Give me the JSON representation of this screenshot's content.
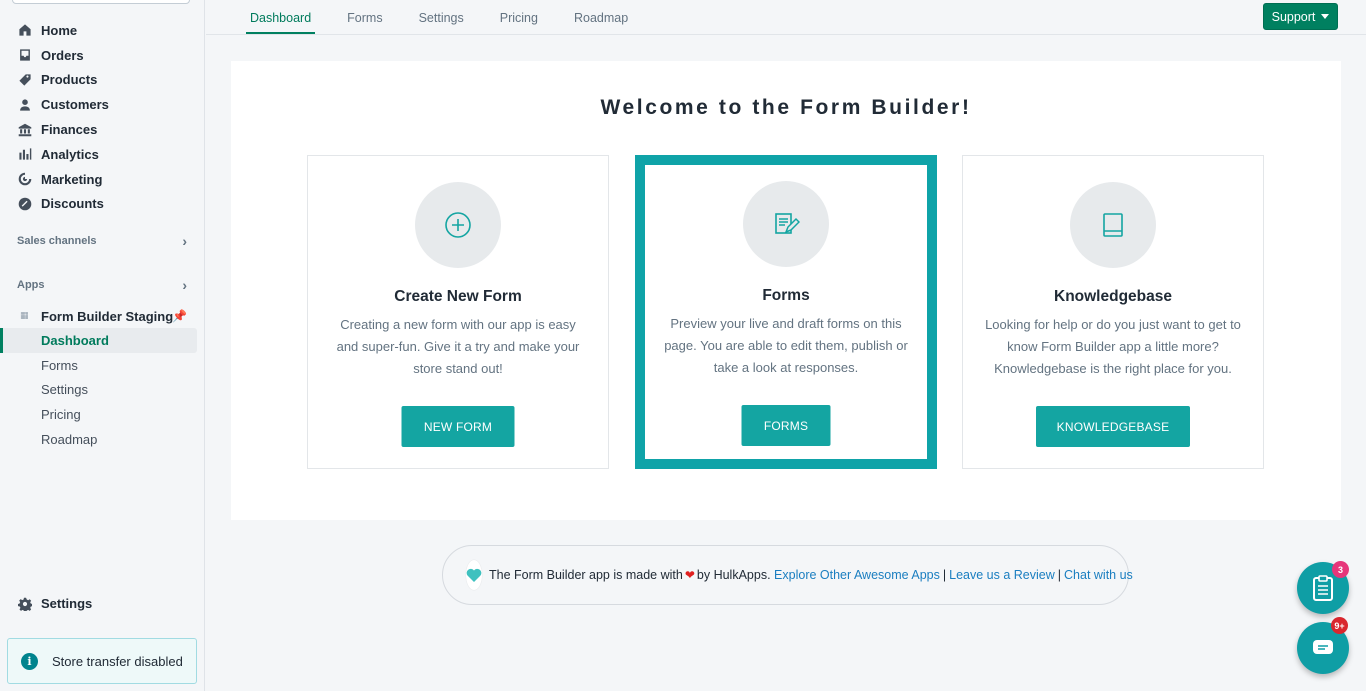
{
  "sidebar": {
    "nav": [
      {
        "label": "Home",
        "icon": "home-icon"
      },
      {
        "label": "Orders",
        "icon": "orders-icon"
      },
      {
        "label": "Products",
        "icon": "tag-icon"
      },
      {
        "label": "Customers",
        "icon": "person-icon"
      },
      {
        "label": "Finances",
        "icon": "bank-icon"
      },
      {
        "label": "Analytics",
        "icon": "bar-chart-icon"
      },
      {
        "label": "Marketing",
        "icon": "target-icon"
      },
      {
        "label": "Discounts",
        "icon": "discount-icon"
      }
    ],
    "sales_channels_label": "Sales channels",
    "apps_label": "Apps",
    "app_name": "Form Builder Staging",
    "app_sub": [
      "Dashboard",
      "Forms",
      "Settings",
      "Pricing",
      "Roadmap"
    ],
    "settings_label": "Settings",
    "transfer_notice": "Store transfer disabled"
  },
  "topnav": {
    "tabs": [
      "Dashboard",
      "Forms",
      "Settings",
      "Pricing",
      "Roadmap"
    ],
    "active_tab": "Dashboard",
    "support_label": "Support"
  },
  "main": {
    "title": "Welcome to the Form Builder!",
    "cards": [
      {
        "title": "Create New Form",
        "desc": "Creating a new form with our app is easy and super-fun. Give it a try and make your store stand out!",
        "button": "NEW FORM",
        "icon": "plus-circle-icon"
      },
      {
        "title": "Forms",
        "desc": "Preview your live and draft forms on this page. You are able to edit them, publish or take a look at responses.",
        "button": "FORMS",
        "icon": "edit-document-icon"
      },
      {
        "title": "Knowledgebase",
        "desc": "Looking for help or do you just want to get to know Form Builder app a little more? Knowledgebase is the right place for you.",
        "button": "KNOWLEDGEBASE",
        "icon": "book-icon"
      }
    ]
  },
  "footer": {
    "prefix": "The Form Builder app is made with",
    "by": "by HulkApps.",
    "link1": "Explore Other Awesome Apps",
    "link2": "Leave us a Review",
    "link3": "Chat with us",
    "separator": "|"
  },
  "floating": {
    "clipboard_badge": "3",
    "chat_badge": "9+"
  },
  "colors": {
    "accent": "#008060",
    "teal": "#14a5a2",
    "highlight_border": "#0fa3a8",
    "link": "#1a7ec0"
  }
}
